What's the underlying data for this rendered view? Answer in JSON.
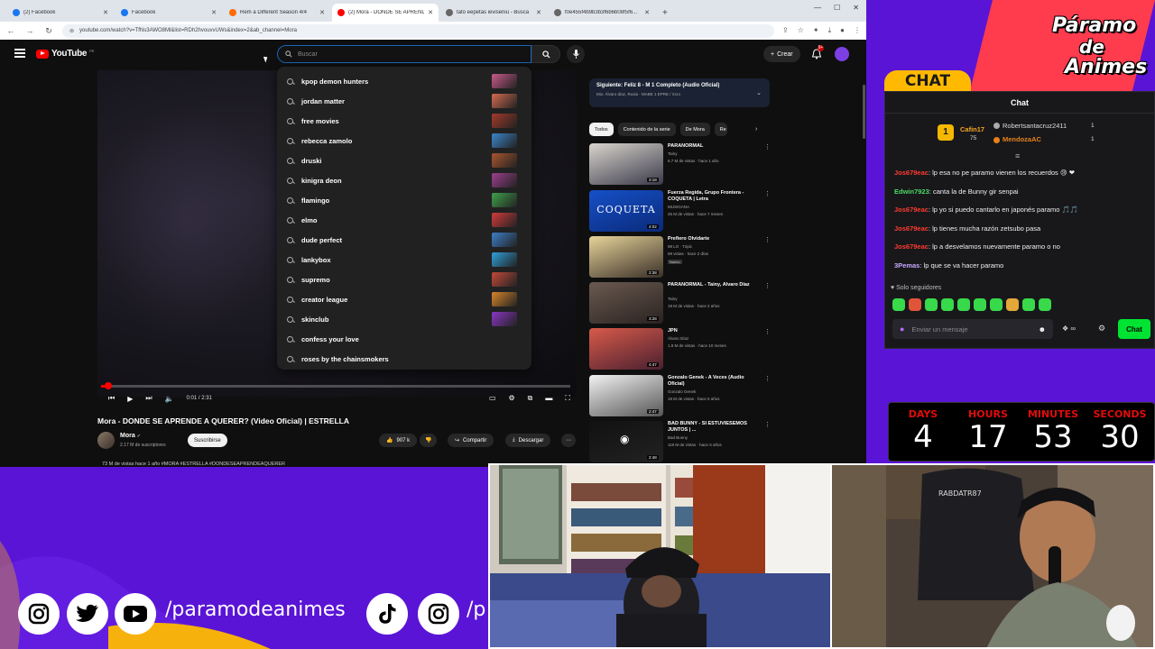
{
  "browser": {
    "tabs": [
      {
        "title": "(2) Facebook",
        "favicon": "facebook-icon",
        "active": false
      },
      {
        "title": "Facebook",
        "favicon": "facebook-icon",
        "active": false
      },
      {
        "title": "Rem a Different Season 4/4",
        "favicon": "crunchyroll-icon",
        "active": false
      },
      {
        "title": "(2) Mora - DONDE SE APRENDE",
        "favicon": "youtube-icon",
        "active": true
      },
      {
        "title": "tato eepetas ieviseniu - Busca",
        "favicon": "search-icon",
        "active": false
      },
      {
        "title": "f0e455f4b9b3b3f6b6b08f5f6...",
        "favicon": "page-icon",
        "active": false
      }
    ],
    "url": "youtube.com/watch?v=TfNs3AWO8Ml&list=RDh2hvouvvUWs&index=2&ab_channel=Mora"
  },
  "youtube": {
    "logo_text": "YouTube",
    "logo_region": "PE",
    "search_placeholder": "Buscar",
    "create_label": "Crear",
    "notifications_count": "9+",
    "suggestions": [
      "kpop demon hunters",
      "jordan matter",
      "free movies",
      "rebecca zamolo",
      "druski",
      "kinigra deon",
      "flamingo",
      "elmo",
      "dude perfect",
      "lankybox",
      "supremo",
      "creator league",
      "skinclub",
      "confess your love",
      "roses by the chainsmokers"
    ],
    "suggestion_thumb_colors": [
      "#c85a8a",
      "#d36b4f",
      "#a33a2a",
      "#3b86c9",
      "#a8552f",
      "#9c3f8f",
      "#3fa04a",
      "#d23b3b",
      "#3d7ec7",
      "#2f9fd9",
      "#c24a3a",
      "#d5852a",
      "#8a36c4",
      "",
      ""
    ],
    "player": {
      "time": "0:01 / 2:31",
      "progress": 0.015
    },
    "video": {
      "title": "Mora - DONDE SE APRENDE A QUERER? (Video Oficial) | ESTRELLA",
      "channel": "Mora",
      "subscribers": "2.17 M de suscriptores",
      "subscribe_label": "Suscribirse",
      "likes": "907 k",
      "share_label": "Compartir",
      "download_label": "Descargar",
      "description": "73 M de vistas  hace 1 año  #MORA #ESTRELLA #DONDESEAPRENDEAQUERER"
    },
    "next_up": {
      "title": "Siguiente: Feliz 8 - M 1 Completo (Audio Oficial)",
      "subtitle": "Mix: Álvaro díaz, Rusia · MABE 1 EPRE / Xcro"
    },
    "chips": [
      "Todos",
      "Contenido de la serie",
      "De Mora",
      "Re"
    ],
    "recommendations": [
      {
        "title": "PARANORMAL",
        "channel": "Tainy",
        "meta": "6.7 M de vistas · hace 1 año",
        "duration": "3:18",
        "colors": [
          "#d9d4cc",
          "#3a3a4a"
        ],
        "badge": ""
      },
      {
        "title": "Fuerza Regida, Grupo Frontera - COQUETA | Letra",
        "channel": "MUSIGANA",
        "meta": "25 M de vistas · hace 7 meses",
        "duration": "4:02",
        "colors": [
          "#1650c8",
          "#0a2a7a"
        ],
        "badge": "",
        "thumb_text": "COQUETA"
      },
      {
        "title": "Prefiero Olvidarte",
        "channel": "98 LO · Tópic",
        "meta": "69 vistas · hace 2 días",
        "duration": "2:38",
        "colors": [
          "#e8d49a",
          "#3a3028"
        ],
        "badge": "Nuevo"
      },
      {
        "title": "PARANORMAL - Tainy, Álvaro Díaz",
        "channel": "Tainy",
        "meta": "19 M de vistas · hace 2 años",
        "duration": "3:28",
        "colors": [
          "#6a5a50",
          "#2a2220"
        ],
        "badge": ""
      },
      {
        "title": "JPN",
        "channel": "Álvaro Díaz",
        "meta": "1.8 M de vistas · hace 10 meses",
        "duration": "4:47",
        "colors": [
          "#d85a4a",
          "#4a2030"
        ],
        "badge": ""
      },
      {
        "title": "Gonzalo Genek - A Veces (Audio Oficial)",
        "channel": "Gonzalo Genek",
        "meta": "19 M de vistas · hace 5 años",
        "duration": "2:47",
        "colors": [
          "#f2f2f2",
          "#555555"
        ],
        "badge": ""
      },
      {
        "title": "BAD BUNNY - SI ESTUVIÉSEMOS JUNTOS | ...",
        "channel": "Bad Bunny",
        "meta": "119 M de vistas · hace 6 años",
        "duration": "2:48",
        "colors": [
          "#111111",
          "#222222"
        ],
        "badge": ""
      }
    ]
  },
  "overlay": {
    "logo_lines": [
      "Páramo",
      "de",
      "Animes"
    ],
    "chat_tab": "CHAT",
    "chat_title": "Chat",
    "leaderboard": [
      {
        "name": "Cafin17",
        "value": "75",
        "color": "#f5a623"
      },
      {
        "name": "Robertsantacruz2411",
        "value": "1",
        "color": "#dddddd"
      },
      {
        "name": "MendozaAC",
        "value": "1",
        "color": "#e8821a"
      }
    ],
    "messages": [
      {
        "user": "Jos679eac",
        "text": ": lp esa no pe paramo vienen los recuerdos 😢 ❤",
        "color": "#ff3b30"
      },
      {
        "user": "Edwin7923",
        "text": ": canta la de Bunny gir senpai",
        "color": "#4cd964"
      },
      {
        "user": "Jos679eac",
        "text": ": lp yo si puedo cantarlo en japonés paramo 🎵🎵",
        "color": "#ff3b30"
      },
      {
        "user": "Jos679eac",
        "text": ": lp tienes mucha razón zetsubo pasa",
        "color": "#ff3b30"
      },
      {
        "user": "Jos679eac",
        "text": ": lp a desvelamos nuevamente paramo o no",
        "color": "#ff3b30"
      },
      {
        "user": "3Pemas",
        "text": ": lp que se va hacer paramo",
        "color": "#c8a8ff"
      }
    ],
    "followers_only": "Solo seguidores",
    "chat_placeholder": "Enviar un mensaje",
    "chat_points": "∞",
    "chat_send": "Chat",
    "countdown": [
      {
        "label": "DAYS",
        "value": "4"
      },
      {
        "label": "HOURS",
        "value": "17"
      },
      {
        "label": "MINUTES",
        "value": "53"
      },
      {
        "label": "SECONDS",
        "value": "30"
      }
    ],
    "social_handle": "/paramodeanimes",
    "social_handle_cut": "/p",
    "cam_chair_text": "RABDATR87"
  },
  "colors": {
    "brand_purple": "#5a14d6",
    "brand_red": "#ff3b4e",
    "brand_yellow": "#ffb900",
    "chat_send_green": "#00e332",
    "youtube_red": "#ff0000"
  }
}
